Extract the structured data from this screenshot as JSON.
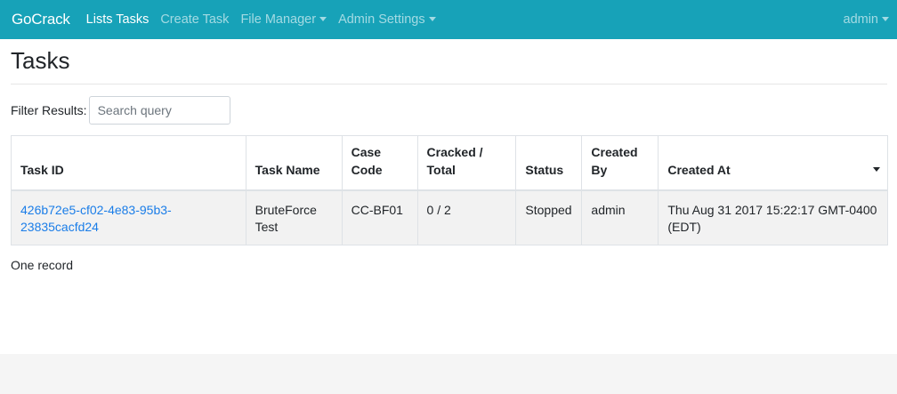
{
  "navbar": {
    "brand": "GoCrack",
    "links": [
      {
        "label": "Lists Tasks",
        "active": true
      },
      {
        "label": "Create Task",
        "active": false
      },
      {
        "label": "File Manager",
        "active": false,
        "dropdown": true
      },
      {
        "label": "Admin Settings",
        "active": false,
        "dropdown": true
      }
    ],
    "user": "admin",
    "color": "#17a2b8"
  },
  "page": {
    "title": "Tasks",
    "filter_label": "Filter Results:",
    "filter_placeholder": "Search query",
    "filter_value": ""
  },
  "table": {
    "columns": [
      [
        "Task ID"
      ],
      [
        "Task Name"
      ],
      [
        "Case",
        "Code"
      ],
      [
        "Cracked /",
        "Total"
      ],
      [
        "Status"
      ],
      [
        "Created",
        "By"
      ],
      [
        "Created At"
      ]
    ],
    "sorted_column": "Created At",
    "rows": [
      {
        "task_id": [
          "426b72e5-cf02-4e83-95b3-",
          "23835cacfd24"
        ],
        "task_name": [
          "BruteForce",
          "Test"
        ],
        "case_code": "CC-BF01",
        "cracked_total": "0 / 2",
        "status": "Stopped",
        "created_by": "admin",
        "created_at": [
          "Thu Aug 31 2017 15:22:17 GMT-0400",
          "(EDT)"
        ]
      }
    ]
  },
  "record_count": "One record",
  "link_color": "#1a7de8"
}
